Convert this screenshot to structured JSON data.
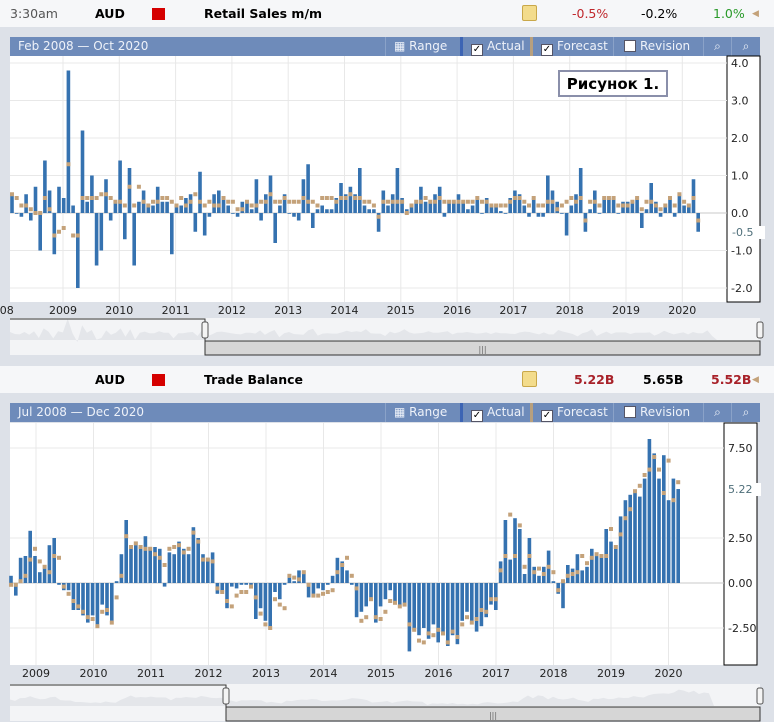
{
  "panel1": {
    "time": "3:30am",
    "currency": "AUD",
    "event": "Retail Sales m/m",
    "actual": "-0.5%",
    "forecast": "-0.2%",
    "previous": "1.0%",
    "range_text": "Feb 2008 — Oct 2020",
    "annotation": "Рисунок 1.",
    "current_label": "-0.5"
  },
  "panel2": {
    "currency": "AUD",
    "event": "Trade Balance",
    "actual": "5.22B",
    "forecast": "5.65B",
    "previous": "5.52B",
    "range_text": "Jul 2008 — Dec 2020",
    "current_label": "5.22"
  },
  "toolbar": {
    "range": "Range",
    "actual": "Actual",
    "forecast": "Forecast",
    "revision": "Revision",
    "actual_checked": true,
    "forecast_checked": true,
    "revision_checked": false,
    "zoom_in_icon": "magnifier-plus",
    "zoom_out_icon": "magnifier-minus",
    "range_icon": "calendar"
  },
  "colors": {
    "actual_bar": "#3572b0",
    "forecast_marker": "#c4a27a",
    "negative_value": "#c0282d",
    "positive_value": "#2a9a2a",
    "toolbar": "#6e8bba"
  },
  "chart_data": [
    {
      "type": "bar",
      "title": "",
      "start": "Feb 2008",
      "frequency": "monthly",
      "ylim": [
        -2.4,
        4.0
      ],
      "yticks": [
        "4.0",
        "3.0",
        "2.0",
        "1.0",
        "0.0",
        "-1.0",
        "-2.0"
      ],
      "xticks": [
        "08",
        "2009",
        "2010",
        "2011",
        "2012",
        "2013",
        "2014",
        "2015",
        "2016",
        "2017",
        "2018",
        "2019",
        "2020"
      ],
      "grid": true,
      "series": [
        {
          "name": "Actual",
          "values": [
            0.5,
            0.0,
            -0.1,
            0.5,
            -0.2,
            0.7,
            -1.0,
            1.4,
            0.6,
            -1.1,
            0.7,
            0.4,
            3.8,
            0.2,
            -2.0,
            2.2,
            0.3,
            1.0,
            -1.4,
            -1.0,
            0.9,
            -0.2,
            0.3,
            1.4,
            -0.7,
            1.2,
            -1.4,
            0.3,
            0.6,
            0.2,
            0.2,
            0.7,
            0.3,
            0.3,
            -1.1,
            0.2,
            0.2,
            0.4,
            0.5,
            -0.5,
            1.1,
            -0.6,
            -0.1,
            0.5,
            0.6,
            0.4,
            0.2,
            0.0,
            -0.1,
            0.3,
            0.3,
            0.1,
            0.9,
            -0.2,
            0.5,
            1.0,
            -0.8,
            0.2,
            0.5,
            0.0,
            -0.1,
            -0.2,
            0.9,
            1.3,
            -0.4,
            0.1,
            0.2,
            0.1,
            0.1,
            0.4,
            0.8,
            0.5,
            0.7,
            0.5,
            1.2,
            0.2,
            0.1,
            0.1,
            -0.5,
            0.6,
            0.2,
            0.5,
            1.2,
            0.4,
            0.1,
            0.2,
            0.3,
            0.7,
            0.3,
            0.3,
            0.5,
            0.7,
            -0.1,
            0.3,
            0.3,
            0.5,
            0.3,
            0.1,
            0.2,
            0.4,
            0.0,
            0.4,
            0.2,
            0.2,
            0.05,
            0.0,
            0.4,
            0.6,
            0.5,
            0.2,
            -0.1,
            0.4,
            -0.1,
            -0.1,
            1.0,
            0.6,
            0.3,
            0.0,
            -0.6,
            0.2,
            0.5,
            1.2,
            -0.5,
            0.1,
            0.6,
            0.0,
            0.4,
            0.4,
            0.4,
            0.0,
            0.3,
            0.3,
            0.3,
            0.4,
            -0.4,
            0.1,
            0.8,
            0.3,
            -0.1,
            0.2,
            0.4,
            -0.1,
            0.5,
            0.2,
            0.2,
            0.9,
            -0.5
          ]
        },
        {
          "name": "Forecast",
          "values": [
            0.5,
            0.4,
            0.2,
            0.2,
            0.1,
            0.0,
            0.0,
            0.4,
            0.1,
            -0.6,
            -0.5,
            -0.4,
            1.3,
            -0.6,
            -0.6,
            0.4,
            0.4,
            0.4,
            0.4,
            0.5,
            0.5,
            0.4,
            0.3,
            0.3,
            0.2,
            0.7,
            0.2,
            0.7,
            0.3,
            0.2,
            0.3,
            0.3,
            0.4,
            0.4,
            0.3,
            0.2,
            0.4,
            0.2,
            0.3,
            0.5,
            0.3,
            0.2,
            0.3,
            0.2,
            0.2,
            0.4,
            0.3,
            0.3,
            0.1,
            0.1,
            0.3,
            0.2,
            0.2,
            0.3,
            0.3,
            0.5,
            0.3,
            0.3,
            0.4,
            0.3,
            0.3,
            0.3,
            0.4,
            0.3,
            0.3,
            0.2,
            0.4,
            0.4,
            0.4,
            0.3,
            0.4,
            0.4,
            0.5,
            0.4,
            0.4,
            0.3,
            0.3,
            0.2,
            -0.1,
            0.3,
            0.3,
            0.3,
            0.3,
            0.3,
            0.0,
            0.2,
            0.3,
            0.3,
            0.4,
            0.3,
            0.3,
            0.4,
            0.3,
            0.3,
            0.3,
            0.3,
            0.3,
            0.3,
            0.3,
            0.4,
            0.3,
            0.3,
            0.2,
            0.2,
            0.2,
            0.2,
            0.3,
            0.4,
            0.4,
            0.3,
            0.2,
            0.4,
            0.2,
            0.2,
            0.3,
            0.3,
            0.1,
            0.2,
            0.3,
            0.4,
            0.3,
            0.4,
            -0.2,
            0.3,
            0.3,
            0.2,
            0.4,
            0.4,
            0.4,
            0.2,
            0.2,
            0.2,
            0.3,
            0.4,
            0.1,
            0.3,
            0.3,
            0.2,
            0.1,
            0.2,
            0.4,
            0.2,
            0.5,
            0.3,
            0.2,
            0.4,
            -0.2
          ]
        }
      ]
    },
    {
      "type": "bar",
      "title": "",
      "start": "Jul 2008",
      "frequency": "monthly",
      "ylim": [
        -4.5,
        8.8
      ],
      "yticks": [
        "7.50",
        "2.50",
        "0.00",
        "-2.50"
      ],
      "xticks": [
        "2009",
        "2010",
        "2011",
        "2012",
        "2013",
        "2014",
        "2015",
        "2016",
        "2017",
        "2018",
        "2019",
        "2020"
      ],
      "grid": true,
      "series": [
        {
          "name": "Actual",
          "values": [
            0.4,
            -0.7,
            1.4,
            1.5,
            2.9,
            1.5,
            0.6,
            0.8,
            2.1,
            2.5,
            -0.1,
            -0.4,
            -0.4,
            -1.5,
            -1.5,
            -1.8,
            -2.2,
            -1.8,
            -2.3,
            -1.2,
            -1.8,
            -2.1,
            0.1,
            1.6,
            3.5,
            1.9,
            2.3,
            2.0,
            2.6,
            2.0,
            2.0,
            1.9,
            -0.2,
            1.7,
            1.6,
            2.3,
            1.9,
            1.6,
            3.1,
            2.5,
            1.6,
            1.4,
            1.7,
            -0.6,
            -0.5,
            -1.4,
            -0.2,
            -0.3,
            -0.1,
            -0.1,
            -0.3,
            -2.0,
            -1.4,
            -2.1,
            -2.6,
            -0.5,
            -0.9,
            -0.1,
            0.3,
            0.1,
            0.7,
            0.5,
            -0.8,
            -0.7,
            -0.3,
            -0.4,
            -0.1,
            0.4,
            1.4,
            1.2,
            0.7,
            -0.1,
            -1.9,
            -1.6,
            -1.3,
            -0.8,
            -2.2,
            -1.3,
            -0.9,
            -0.4,
            -1.1,
            -1.2,
            -1.3,
            -3.8,
            -2.6,
            -2.9,
            -2.5,
            -3.1,
            -2.3,
            -3.3,
            -2.9,
            -3.5,
            -2.9,
            -3.4,
            -2.1,
            -1.6,
            -2.1,
            -2.7,
            -2.4,
            -1.9,
            -1.2,
            -1.5,
            1.2,
            3.5,
            1.3,
            3.6,
            3.0,
            0.5,
            2.5,
            0.9,
            0.4,
            0.9,
            1.8,
            0.1,
            -0.6,
            -1.4,
            1.0,
            0.8,
            1.6,
            0.7,
            0.9,
            1.9,
            1.5,
            1.6,
            3.0,
            2.3,
            1.9,
            3.7,
            4.6,
            4.9,
            5.1,
            4.8,
            5.8,
            8.0,
            7.2,
            5.8,
            7.1,
            4.6,
            5.8,
            5.22
          ]
        },
        {
          "name": "Forecast",
          "values": [
            -0.1,
            -0.1,
            0.1,
            0.4,
            1.3,
            1.9,
            1.2,
            0.9,
            0.6,
            1.5,
            1.4,
            -0.2,
            -0.6,
            -1.0,
            -1.3,
            -1.6,
            -1.9,
            -2.0,
            -2.4,
            -1.6,
            -1.5,
            -2.2,
            -0.8,
            0.4,
            2.6,
            2.0,
            2.2,
            2.0,
            1.9,
            1.9,
            1.6,
            1.4,
            1.0,
            1.9,
            2.0,
            2.1,
            1.7,
            1.9,
            2.8,
            2.3,
            1.3,
            1.3,
            1.2,
            -0.3,
            -0.5,
            -1.0,
            -1.3,
            -0.7,
            -0.5,
            -0.5,
            -0.2,
            -0.8,
            -1.7,
            -2.3,
            -2.5,
            -0.9,
            -1.2,
            -1.4,
            0.4,
            0.3,
            0.2,
            0.6,
            -0.1,
            -0.7,
            -0.7,
            -0.6,
            -0.5,
            -0.4,
            0.6,
            1.0,
            1.4,
            0.4,
            -0.3,
            -2.1,
            -1.9,
            -0.9,
            -1.9,
            -2.0,
            -1.6,
            -1.0,
            -1.1,
            -1.3,
            -1.2,
            -2.3,
            -2.6,
            -3.2,
            -3.3,
            -2.8,
            -2.9,
            -2.6,
            -2.8,
            -3.3,
            -2.7,
            -3.0,
            -2.3,
            -1.9,
            -2.2,
            -2.0,
            -1.5,
            -1.6,
            -0.9,
            -0.9,
            0.7,
            1.5,
            3.8,
            1.5,
            3.2,
            0.9,
            1.5,
            0.6,
            0.8,
            0.5,
            0.9,
            0.6,
            -0.4,
            0.1,
            0.4,
            0.5,
            0.6,
            1.5,
            1.1,
            1.4,
            1.6,
            1.5,
            1.5,
            3.0,
            2.0,
            2.7,
            3.6,
            4.1,
            5.1,
            5.4,
            6.0,
            6.3,
            7.0,
            6.3,
            5.0,
            6.8,
            4.6,
            5.6
          ]
        }
      ]
    }
  ]
}
